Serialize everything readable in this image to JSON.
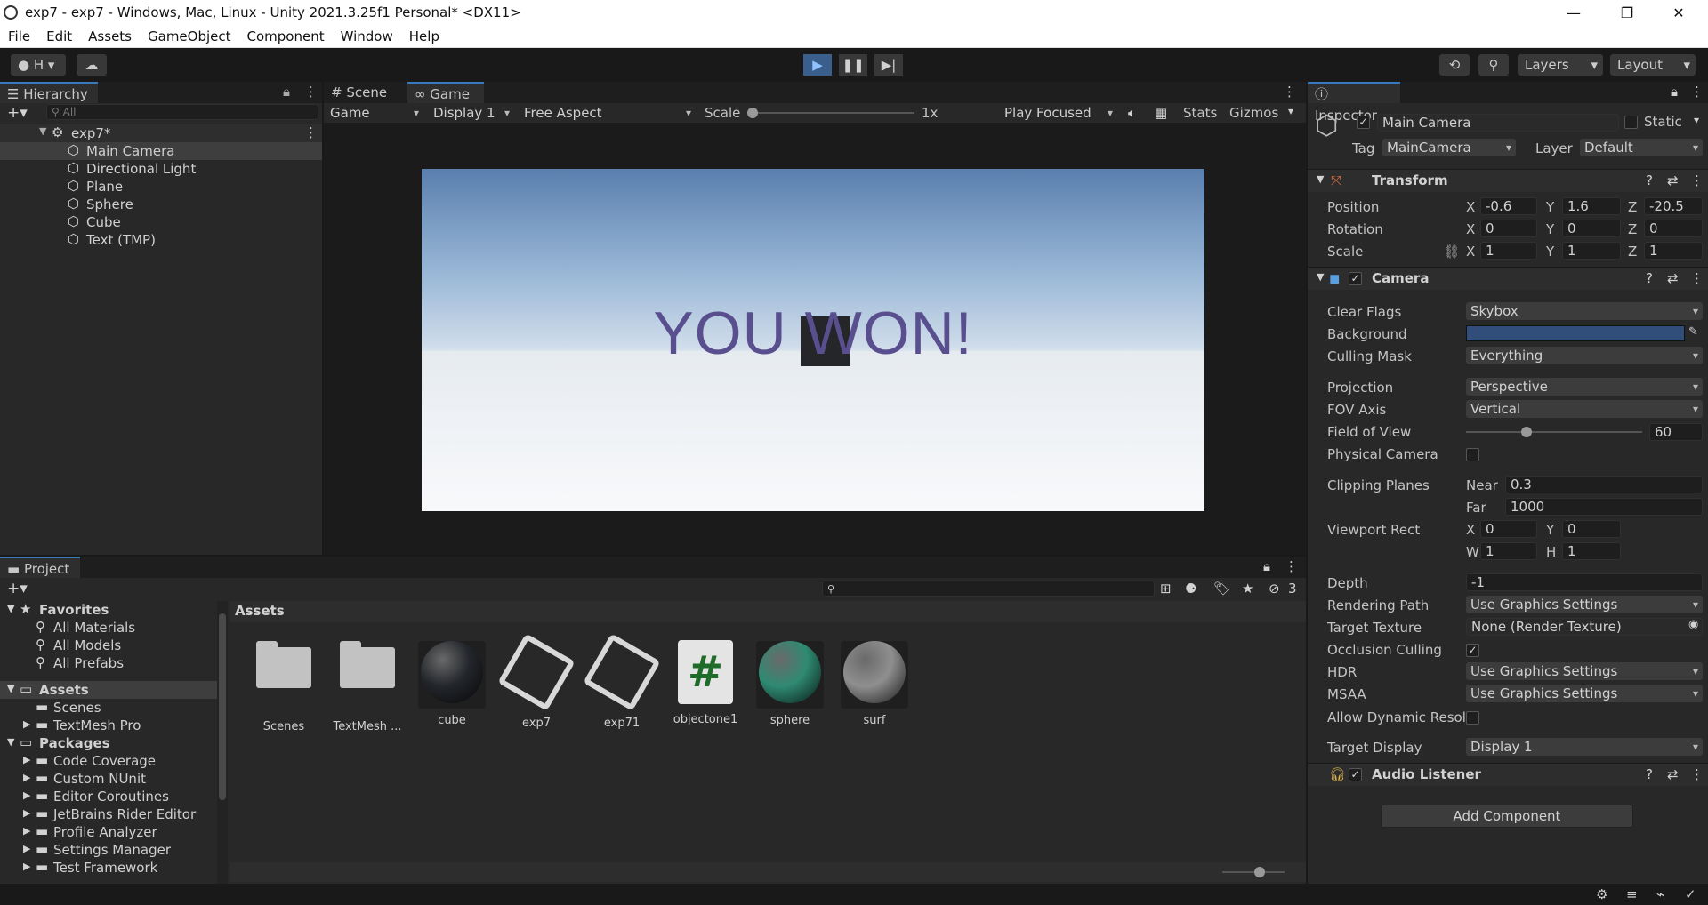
{
  "window": {
    "title": "exp7 - exp7 - Windows, Mac, Linux - Unity 2021.3.25f1 Personal* <DX11>"
  },
  "menu": [
    "File",
    "Edit",
    "Assets",
    "GameObject",
    "Component",
    "Window",
    "Help"
  ],
  "toolbar": {
    "account": "H",
    "layers": "Layers",
    "layout": "Layout"
  },
  "hierarchy": {
    "tab": "Hierarchy",
    "search_placeholder": "All",
    "scene": "exp7*",
    "items": [
      "Main Camera",
      "Directional Light",
      "Plane",
      "Sphere",
      "Cube",
      "Text (TMP)"
    ]
  },
  "game": {
    "tabs": [
      "Scene",
      "Game"
    ],
    "mode": "Game",
    "display": "Display 1",
    "aspect": "Free Aspect",
    "scale_label": "Scale",
    "scale_value": "1x",
    "play_mode": "Play Focused",
    "stats": "Stats",
    "gizmos": "Gizmos",
    "viewport_text": "YOU WON!"
  },
  "project": {
    "tab": "Project",
    "favorites_label": "Favorites",
    "favorites": [
      "All Materials",
      "All Models",
      "All Prefabs"
    ],
    "assets_label": "Assets",
    "assets_folders": [
      "Scenes",
      "TextMesh Pro"
    ],
    "packages_label": "Packages",
    "packages": [
      "Code Coverage",
      "Custom NUnit",
      "Editor Coroutines",
      "JetBrains Rider Editor",
      "Profile Analyzer",
      "Settings Manager",
      "Test Framework"
    ],
    "breadcrumb": "Assets",
    "hidden_count": "3",
    "items": [
      {
        "name": "Scenes",
        "kind": "folder"
      },
      {
        "name": "TextMesh ...",
        "kind": "folder"
      },
      {
        "name": "cube",
        "kind": "material",
        "color": "#23262b"
      },
      {
        "name": "exp7",
        "kind": "unity"
      },
      {
        "name": "exp71",
        "kind": "unity"
      },
      {
        "name": "objectone1",
        "kind": "script"
      },
      {
        "name": "sphere",
        "kind": "material",
        "color": "#2f8a72"
      },
      {
        "name": "surf",
        "kind": "material",
        "color": "#8f8f8f"
      }
    ]
  },
  "inspector": {
    "tab": "Inspector",
    "object_name": "Main Camera",
    "static_label": "Static",
    "tag_label": "Tag",
    "tag": "MainCamera",
    "layer_label": "Layer",
    "layer": "Default",
    "transform": {
      "title": "Transform",
      "position_label": "Position",
      "rotation_label": "Rotation",
      "scale_label": "Scale",
      "position": {
        "x": "-0.6",
        "y": "1.6",
        "z": "-20.5"
      },
      "rotation": {
        "x": "0",
        "y": "0",
        "z": "0"
      },
      "scale": {
        "x": "1",
        "y": "1",
        "z": "1"
      }
    },
    "camera": {
      "title": "Camera",
      "clear_flags_label": "Clear Flags",
      "clear_flags": "Skybox",
      "background_label": "Background",
      "background_color": "#314d79",
      "culling_mask_label": "Culling Mask",
      "culling_mask": "Everything",
      "projection_label": "Projection",
      "projection": "Perspective",
      "fov_axis_label": "FOV Axis",
      "fov_axis": "Vertical",
      "fov_label": "Field of View",
      "fov": "60",
      "physical_label": "Physical Camera",
      "clipping_label": "Clipping Planes",
      "near_label": "Near",
      "near": "0.3",
      "far_label": "Far",
      "far": "1000",
      "viewport_label": "Viewport Rect",
      "vp_x": "0",
      "vp_y": "0",
      "vp_w": "1",
      "vp_h": "1",
      "depth_label": "Depth",
      "depth": "-1",
      "rendering_path_label": "Rendering Path",
      "rendering_path": "Use Graphics Settings",
      "target_texture_label": "Target Texture",
      "target_texture": "None (Render Texture)",
      "occlusion_label": "Occlusion Culling",
      "hdr_label": "HDR",
      "hdr": "Use Graphics Settings",
      "msaa_label": "MSAA",
      "msaa": "Use Graphics Settings",
      "dynamic_res_label": "Allow Dynamic Resol",
      "target_display_label": "Target Display",
      "target_display": "Display 1"
    },
    "audio_listener": "Audio Listener",
    "add_component": "Add Component"
  }
}
